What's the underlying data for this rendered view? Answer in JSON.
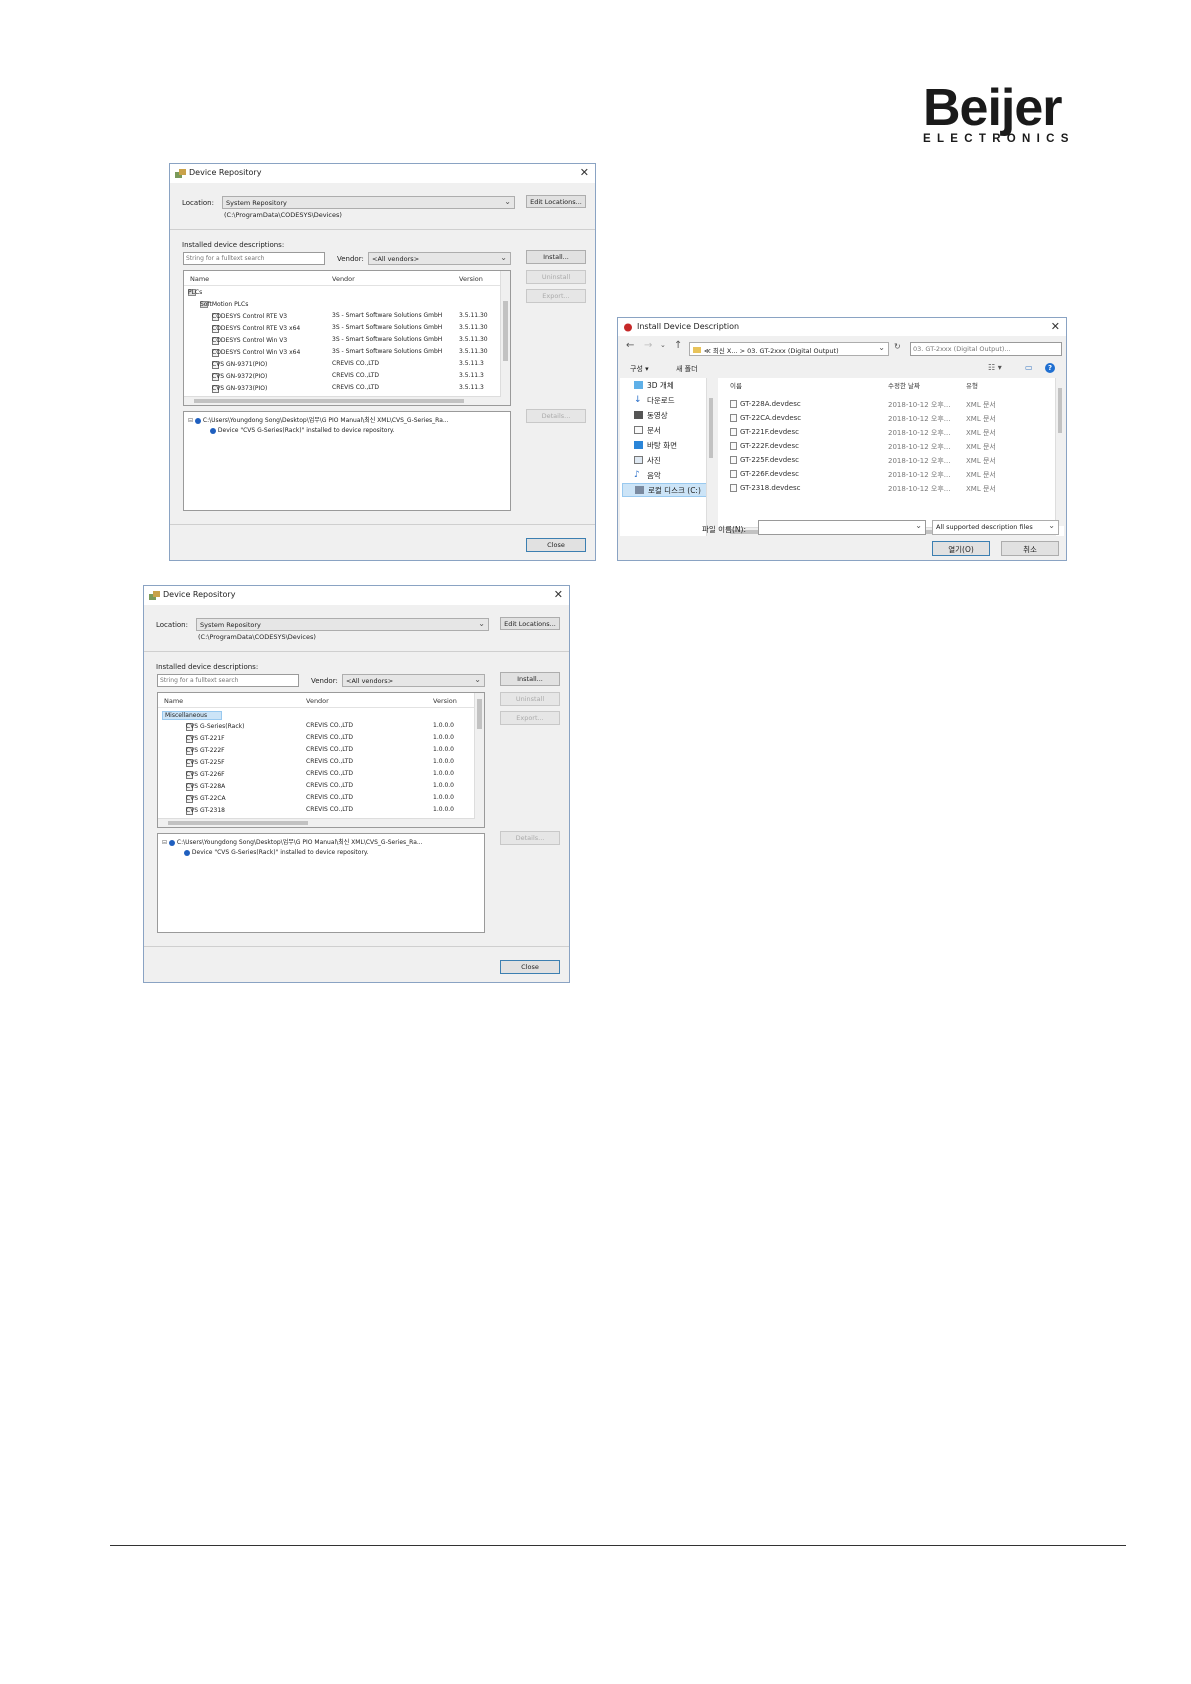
{
  "logo": {
    "word": "Beijer",
    "sub": "ELECTRONICS"
  },
  "dialog1": {
    "title": "Device Repository",
    "location_label": "Location:",
    "location_value": "System Repository",
    "location_path": "(C:\\ProgramData\\CODESYS\\Devices)",
    "edit_locations": "Edit Locations...",
    "installed_label": "Installed device descriptions:",
    "search_placeholder": "String for a fulltext search",
    "vendor_label": "Vendor:",
    "vendor_value": "<All vendors>",
    "install": "Install...",
    "uninstall": "Uninstall",
    "export": "Export...",
    "details": "Details...",
    "close": "Close",
    "columns": [
      "Name",
      "Vendor",
      "Version"
    ],
    "rows": [
      {
        "name": "PLCs",
        "vendor": "",
        "version": ""
      },
      {
        "name": "SoftMotion PLCs",
        "vendor": "",
        "version": ""
      },
      {
        "name": "CODESYS Control RTE V3",
        "vendor": "3S - Smart Software Solutions GmbH",
        "version": "3.5.11.30"
      },
      {
        "name": "CODESYS Control RTE V3 x64",
        "vendor": "3S - Smart Software Solutions GmbH",
        "version": "3.5.11.30"
      },
      {
        "name": "CODESYS Control Win V3",
        "vendor": "3S - Smart Software Solutions GmbH",
        "version": "3.5.11.30"
      },
      {
        "name": "CODESYS Control Win V3 x64",
        "vendor": "3S - Smart Software Solutions GmbH",
        "version": "3.5.11.30"
      },
      {
        "name": "CVS GN-9371(PIO)",
        "vendor": "CREVIS CO.,LTD",
        "version": "3.5.11.3"
      },
      {
        "name": "CVS GN-9372(PIO)",
        "vendor": "CREVIS CO.,LTD",
        "version": "3.5.11.3"
      },
      {
        "name": "CVS GN-9373(PIO)",
        "vendor": "CREVIS CO.,LTD",
        "version": "3.5.11.3"
      }
    ],
    "log_path": "C:\\Users\\Youngdong Song\\Desktop\\업무\\G PIO Manual\\최신 XML\\CVS_G-Series_Ra...",
    "log_msg": "Device \"CVS G-Series(Rack)\" installed to device repository."
  },
  "dialog2": {
    "title": "Install Device Description",
    "breadcrumb": [
      "≪ 최신 X...",
      "03. GT-2xxx (Digital Output)"
    ],
    "search_placeholder": "03. GT-2xxx (Digital Output)...",
    "organize": "구성 ▾",
    "new_folder": "새 폴더",
    "sidebar": [
      "3D 개체",
      "다운로드",
      "동영상",
      "문서",
      "바탕 화면",
      "사진",
      "음악",
      "로컬 디스크 (C:)"
    ],
    "columns": [
      "이름",
      "수정한 날짜",
      "유형"
    ],
    "files": [
      {
        "name": "GT-228A.devdesc",
        "date": "2018-10-12 오후...",
        "type": "XML 문서"
      },
      {
        "name": "GT-22CA.devdesc",
        "date": "2018-10-12 오후...",
        "type": "XML 문서"
      },
      {
        "name": "GT-221F.devdesc",
        "date": "2018-10-12 오후...",
        "type": "XML 문서"
      },
      {
        "name": "GT-222F.devdesc",
        "date": "2018-10-12 오후...",
        "type": "XML 문서"
      },
      {
        "name": "GT-225F.devdesc",
        "date": "2018-10-12 오후...",
        "type": "XML 문서"
      },
      {
        "name": "GT-226F.devdesc",
        "date": "2018-10-12 오후...",
        "type": "XML 문서"
      },
      {
        "name": "GT-2318.devdesc",
        "date": "2018-10-12 오후...",
        "type": "XML 문서"
      }
    ],
    "filename_label": "파일 이름(N):",
    "filetype": "All supported description files",
    "open": "열기(O)",
    "cancel": "취소"
  },
  "dialog3": {
    "title": "Device Repository",
    "location_label": "Location:",
    "location_value": "System Repository",
    "location_path": "(C:\\ProgramData\\CODESYS\\Devices)",
    "edit_locations": "Edit Locations...",
    "installed_label": "Installed device descriptions:",
    "search_placeholder": "String for a fulltext search",
    "vendor_label": "Vendor:",
    "vendor_value": "<All vendors>",
    "install": "Install...",
    "uninstall": "Uninstall",
    "export": "Export...",
    "details": "Details...",
    "close": "Close",
    "columns": [
      "Name",
      "Vendor",
      "Version"
    ],
    "rows": [
      {
        "name": "Miscellaneous",
        "vendor": "",
        "version": ""
      },
      {
        "name": "CVS G-Series(Rack)",
        "vendor": "CREVIS CO.,LTD",
        "version": "1.0.0.0"
      },
      {
        "name": "CVS GT-221F",
        "vendor": "CREVIS CO.,LTD",
        "version": "1.0.0.0"
      },
      {
        "name": "CVS GT-222F",
        "vendor": "CREVIS CO.,LTD",
        "version": "1.0.0.0"
      },
      {
        "name": "CVS GT-225F",
        "vendor": "CREVIS CO.,LTD",
        "version": "1.0.0.0"
      },
      {
        "name": "CVS GT-226F",
        "vendor": "CREVIS CO.,LTD",
        "version": "1.0.0.0"
      },
      {
        "name": "CVS GT-228A",
        "vendor": "CREVIS CO.,LTD",
        "version": "1.0.0.0"
      },
      {
        "name": "CVS GT-22CA",
        "vendor": "CREVIS CO.,LTD",
        "version": "1.0.0.0"
      },
      {
        "name": "CVS GT-2318",
        "vendor": "CREVIS CO.,LTD",
        "version": "1.0.0.0"
      }
    ],
    "log_path": "C:\\Users\\Youngdong Song\\Desktop\\업무\\G PIO Manual\\최신 XML\\CVS_G-Series_Ra...",
    "log_msg": "Device \"CVS G-Series(Rack)\" installed to device repository."
  }
}
